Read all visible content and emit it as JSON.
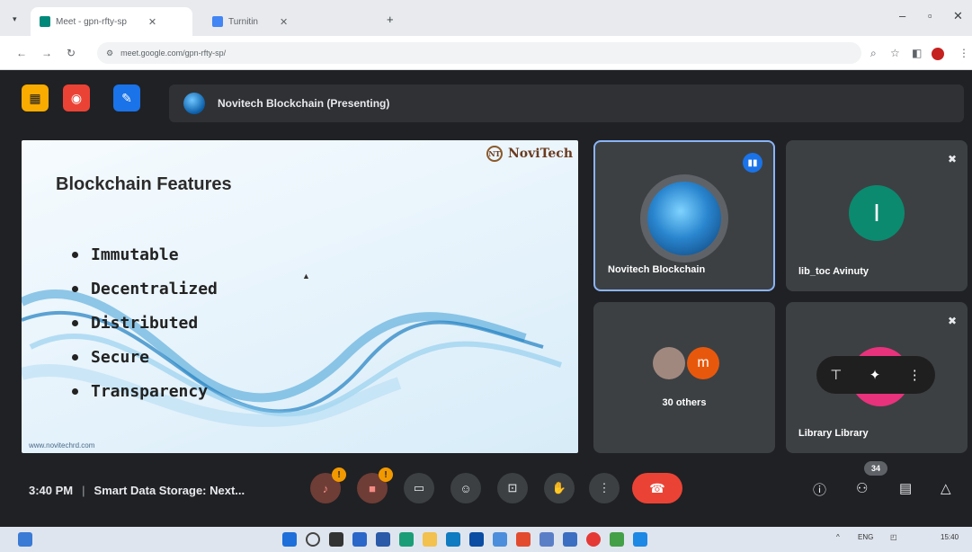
{
  "browser": {
    "tabs": [
      {
        "label": "Meet - gpn-rfty-sp",
        "accent": "#1a73e8"
      },
      {
        "label": "Turnitin",
        "accent": "#4285f4"
      }
    ],
    "address": "meet.google.com/gpn-rfty-sp/"
  },
  "meet": {
    "presenting_label": "Novitech Blockchain (Presenting)",
    "slide": {
      "logo_text": "NoviTech",
      "logo_mark": "NT",
      "title": "Blockchain Features",
      "bullets": [
        "Immutable",
        "Decentralized",
        "Distributed",
        "Secure",
        "Transparency"
      ],
      "footer": "www.novitechrd.com"
    },
    "participants": [
      {
        "name": "Novitech Blockchain",
        "speaking": true
      },
      {
        "name": "lib_toc Avinuty",
        "initial": "I",
        "muted": true
      },
      {
        "name": "30 others",
        "initial": "m"
      },
      {
        "name": "Library Library",
        "muted": true
      }
    ],
    "time": "3:40 PM",
    "meeting_title": "Smart Data Storage: Next...",
    "participant_count": "34",
    "colors": {
      "end_call": "#ea4335",
      "active_border": "#8ab4f8",
      "avatar_green": "#0b8a6f",
      "avatar_pink": "#e8327b",
      "warn": "#f29900"
    }
  },
  "icons": {
    "mic": "mic-off-icon",
    "cam": "camera-off-icon",
    "cc": "captions-icon",
    "emoji": "emoji-icon",
    "present": "present-icon",
    "hand": "raise-hand-icon",
    "more": "more-vert-icon",
    "end": "call-end-icon",
    "info": "info-icon",
    "people": "people-icon",
    "chat": "chat-icon",
    "activities": "activities-icon"
  },
  "taskbar": {
    "tray_lang": "ENG",
    "tray_time": "15:40"
  }
}
